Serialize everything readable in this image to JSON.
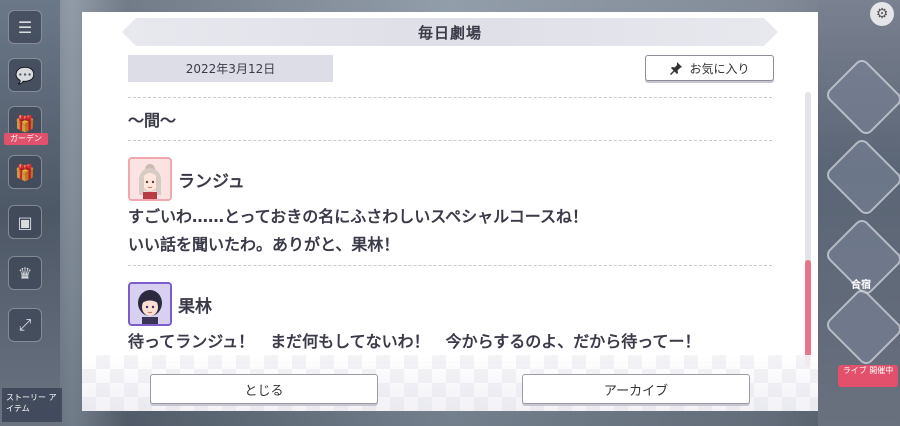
{
  "dialog": {
    "title": "毎日劇場",
    "date": "2022年3月12日",
    "favorite_label": "お気に入り",
    "section_title": "〜間〜",
    "entries": [
      {
        "speaker": "ランジュ",
        "lines": [
          "すごいわ……とっておきの名にふさわしいスペシャルコースね！",
          "いい話を聞いたわ。ありがと、果林！"
        ]
      },
      {
        "speaker": "果林",
        "lines": [
          "待ってランジュ！　まだ何もしてないわ！　今からするのよ、だから待ってー！"
        ]
      }
    ],
    "close_label": "とじる",
    "archive_label": "アーカイブ"
  },
  "background": {
    "left_badge": "ガーデン",
    "left_bottom": "ストーリー アイテム",
    "right_label": "合宿",
    "right_pink": "ライブ 開催中"
  },
  "scroll": {
    "position": 0.8
  },
  "colors": {
    "accent_pink": "#e8758a",
    "title_bar": "#dedfe7",
    "text": "#3a3a48"
  }
}
